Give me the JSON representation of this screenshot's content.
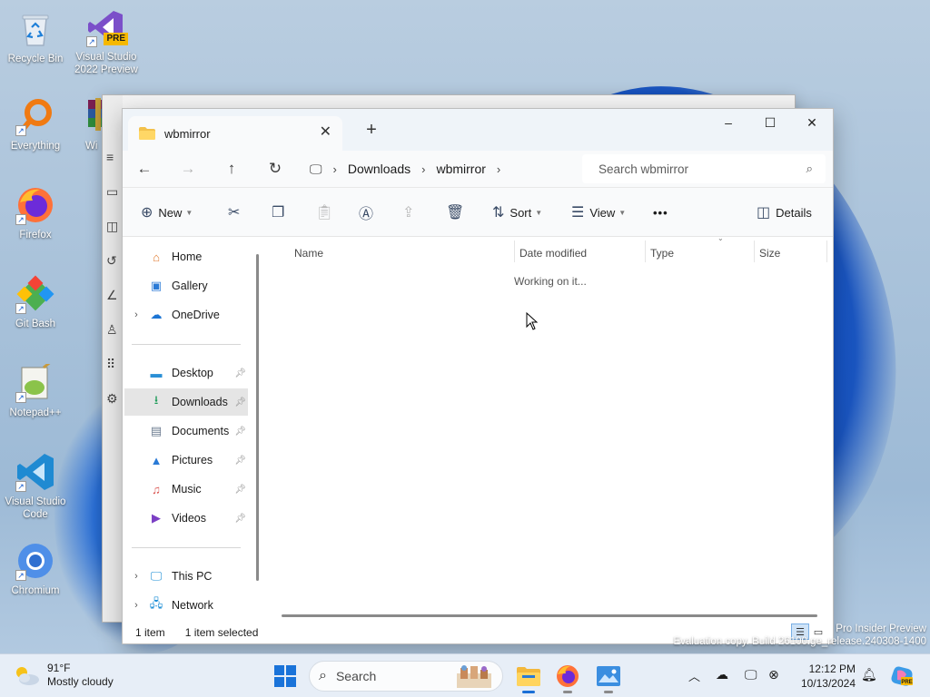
{
  "desktop": {
    "icons": [
      {
        "label": "Recycle Bin",
        "icon": "recycle-bin-icon"
      },
      {
        "label": "Visual Studio 2022 Preview",
        "icon": "visual-studio-icon",
        "badge": "PRE"
      },
      {
        "label": "Everything",
        "icon": "everything-search-icon"
      },
      {
        "label": "Wi",
        "icon": "winrar-icon"
      },
      {
        "label": "Firefox",
        "icon": "firefox-icon"
      },
      {
        "label": "Git Bash",
        "icon": "git-bash-icon"
      },
      {
        "label": "Notepad++",
        "icon": "notepad-plus-plus-icon"
      },
      {
        "label": "Visual Studio Code",
        "icon": "vscode-icon"
      },
      {
        "label": "Chromium",
        "icon": "chromium-icon"
      }
    ],
    "watermark": {
      "line1": "Pro Insider Preview",
      "line2": "Evaluation copy. Build 26100.ge_release.240308-1400"
    }
  },
  "explorer": {
    "tab_title": "wbmirror",
    "caption": {
      "minimize": "–",
      "maximize": "☐",
      "close": "✕"
    },
    "nav": {
      "back": "←",
      "forward": "→",
      "up": "↑",
      "refresh": "↻"
    },
    "breadcrumb": [
      "Downloads",
      "wbmirror"
    ],
    "search_placeholder": "Search wbmirror",
    "toolbar": {
      "new_label": "New",
      "sort_label": "Sort",
      "view_label": "View",
      "more_label": "•••",
      "details_label": "Details"
    },
    "sidebar": {
      "quick": [
        {
          "label": "Home",
          "icon": "home-icon"
        },
        {
          "label": "Gallery",
          "icon": "gallery-icon"
        },
        {
          "label": "OneDrive",
          "icon": "onedrive-icon"
        }
      ],
      "pinned": [
        {
          "label": "Desktop",
          "icon": "desktop-folder-icon"
        },
        {
          "label": "Downloads",
          "icon": "downloads-icon",
          "selected": true
        },
        {
          "label": "Documents",
          "icon": "documents-icon"
        },
        {
          "label": "Pictures",
          "icon": "pictures-icon"
        },
        {
          "label": "Music",
          "icon": "music-icon"
        },
        {
          "label": "Videos",
          "icon": "videos-icon"
        }
      ],
      "locations": [
        {
          "label": "This PC",
          "icon": "this-pc-icon"
        },
        {
          "label": "Network",
          "icon": "network-icon"
        }
      ]
    },
    "columns": [
      "Name",
      "Date modified",
      "Type",
      "Size"
    ],
    "working_text": "Working on it...",
    "status": {
      "items": "1 item",
      "selected": "1 item selected"
    }
  },
  "taskbar": {
    "weather": {
      "temp": "91°F",
      "condition": "Mostly cloudy"
    },
    "search_label": "Search",
    "clock": {
      "time": "12:12 PM",
      "date": "10/13/2024"
    }
  },
  "colors": {
    "accent": "#1a6fd6",
    "selected_nav_bg": "#e5e5e5",
    "titlebar_bg": "#eff4f9"
  }
}
